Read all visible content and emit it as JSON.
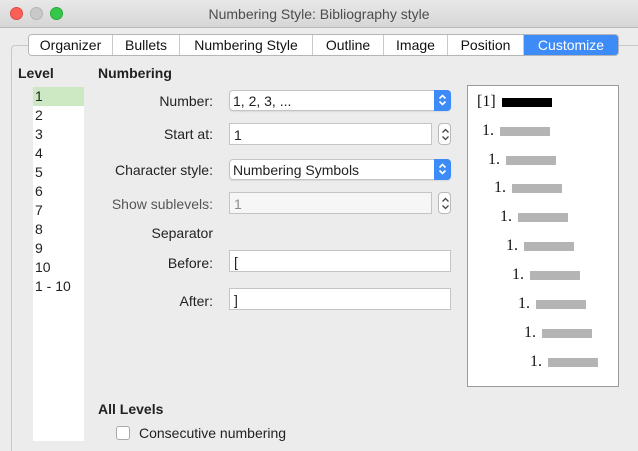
{
  "window": {
    "title": "Numbering Style: Bibliography style"
  },
  "tabs": [
    {
      "label": "Organizer"
    },
    {
      "label": "Bullets"
    },
    {
      "label": "Numbering Style"
    },
    {
      "label": "Outline"
    },
    {
      "label": "Image"
    },
    {
      "label": "Position"
    },
    {
      "label": "Customize",
      "active": true
    }
  ],
  "level": {
    "heading": "Level",
    "items": [
      "1",
      "2",
      "3",
      "4",
      "5",
      "6",
      "7",
      "8",
      "9",
      "10",
      "1 - 10"
    ],
    "selected": "1"
  },
  "numbering": {
    "heading": "Numbering",
    "number_label": "Number:",
    "number_value": "1, 2, 3, ...",
    "start_label": "Start at:",
    "start_value": "1",
    "char_style_label": "Character style:",
    "char_style_value": "Numbering Symbols",
    "sublevels_label": "Show sublevels:",
    "sublevels_value": "1",
    "separator_label": "Separator",
    "before_label": "Before:",
    "before_value": "[",
    "after_label": "After:",
    "after_value": "]"
  },
  "preview": {
    "first_label": "[1]",
    "level_label": "1."
  },
  "all_levels": {
    "heading": "All Levels",
    "consecutive_label": "Consecutive numbering",
    "consecutive_checked": false
  },
  "colors": {
    "accent": "#3d8bf7",
    "selected_level": "#cde9c3"
  }
}
